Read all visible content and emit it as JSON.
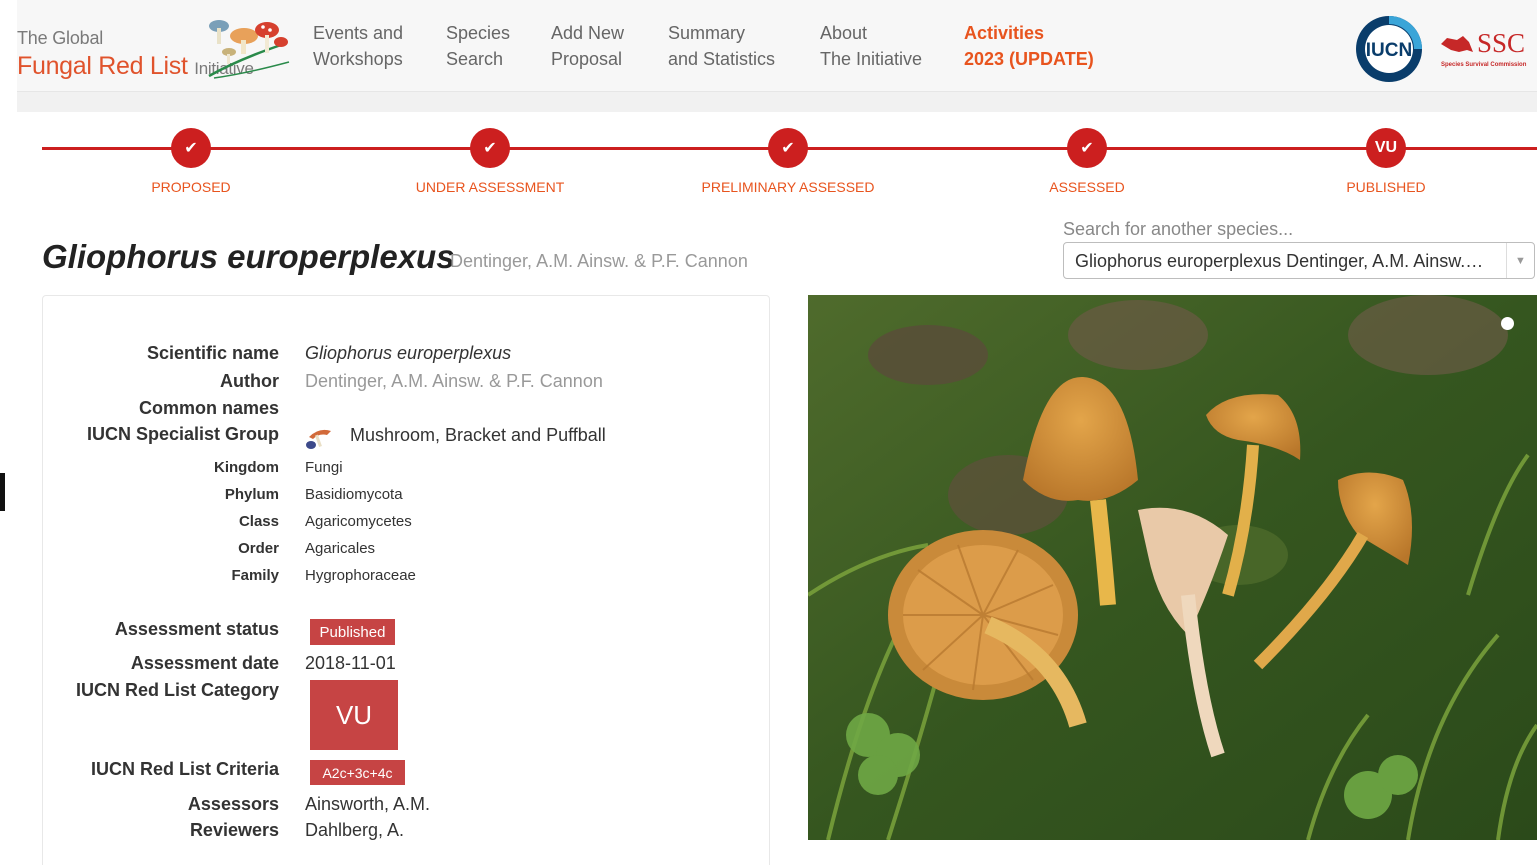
{
  "header": {
    "logo_line1": "The Global",
    "logo_line2": "Fungal Red List",
    "logo_line2_small": "Initiative",
    "nav": [
      {
        "line1": "Events and",
        "line2": "Workshops"
      },
      {
        "line1": "Species",
        "line2": "Search"
      },
      {
        "line1": "Add New",
        "line2": "Proposal"
      },
      {
        "line1": "Summary",
        "line2": "and Statistics"
      },
      {
        "line1": "About",
        "line2": "The Initiative"
      },
      {
        "line1": "Activities",
        "line2": "2023 (UPDATE)",
        "active": true
      }
    ],
    "iucn_text": "IUCN",
    "ssc_text": "SSC",
    "ssc_sub": "Species Survival Commission"
  },
  "progress": {
    "steps": [
      {
        "label": "PROPOSED",
        "mark": "✔"
      },
      {
        "label": "UNDER ASSESSMENT",
        "mark": "✔"
      },
      {
        "label": "PRELIMINARY ASSESSED",
        "mark": "✔"
      },
      {
        "label": "ASSESSED",
        "mark": "✔"
      },
      {
        "label": "PUBLISHED",
        "mark": "VU"
      }
    ],
    "accent_color": "#cc1f1f"
  },
  "species": {
    "title": "Gliophorus europerplexus",
    "author": "Dentinger, A.M. Ainsw. & P.F. Cannon"
  },
  "search": {
    "hint": "Search for another species...",
    "value": "Gliophorus europerplexus Dentinger, A.M. Ainsw.…"
  },
  "info": {
    "scientific_name_label": "Scientific name",
    "scientific_name": "Gliophorus europerplexus",
    "author_label": "Author",
    "author": "Dentinger, A.M. Ainsw. & P.F. Cannon",
    "common_names_label": "Common names",
    "specialist_group_label": "IUCN Specialist Group",
    "specialist_group": "Mushroom, Bracket and Puffball",
    "kingdom_label": "Kingdom",
    "kingdom": "Fungi",
    "phylum_label": "Phylum",
    "phylum": "Basidiomycota",
    "class_label": "Class",
    "class": "Agaricomycetes",
    "order_label": "Order",
    "order": "Agaricales",
    "family_label": "Family",
    "family": "Hygrophoraceae",
    "status_label": "Assessment status",
    "status": "Published",
    "date_label": "Assessment date",
    "date": "2018-11-01",
    "category_label": "IUCN Red List Category",
    "category": "VU",
    "criteria_label": "IUCN Red List Criteria",
    "criteria": "A2c+3c+4c",
    "assessors_label": "Assessors",
    "assessors": "Ainsworth, A.M.",
    "reviewers_label": "Reviewers",
    "reviewers": "Dahlberg, A."
  },
  "colors": {
    "brand_orange": "#e8541e",
    "badge_red": "#c64444"
  }
}
